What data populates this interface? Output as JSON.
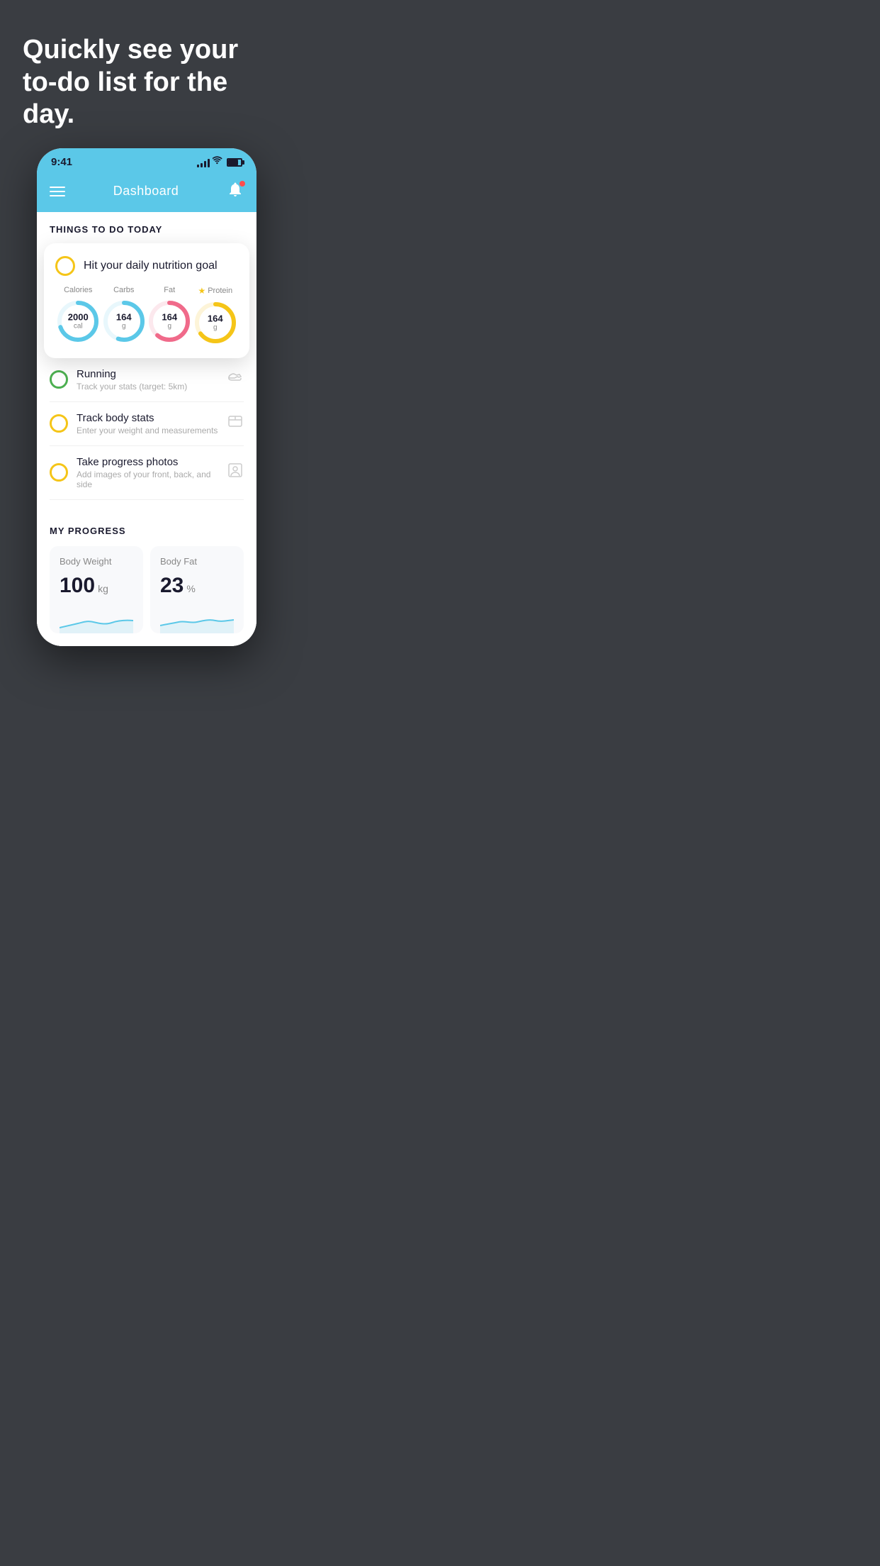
{
  "background_color": "#3a3d42",
  "hero": {
    "title": "Quickly see your to-do list for the day."
  },
  "phone": {
    "status_bar": {
      "time": "9:41",
      "signal_bars": [
        4,
        6,
        9,
        12,
        14
      ],
      "wifi": "wifi",
      "battery": "battery"
    },
    "nav": {
      "title": "Dashboard",
      "menu_label": "menu",
      "bell_label": "notifications"
    },
    "things_to_do": {
      "section_title": "THINGS TO DO TODAY"
    },
    "floating_card": {
      "goal_title": "Hit your daily nutrition goal",
      "nutrients": [
        {
          "label": "Calories",
          "value": "2000",
          "unit": "cal",
          "color": "#5bc8e8",
          "track_pct": 70,
          "star": false
        },
        {
          "label": "Carbs",
          "value": "164",
          "unit": "g",
          "color": "#5bc8e8",
          "track_pct": 55,
          "star": false
        },
        {
          "label": "Fat",
          "value": "164",
          "unit": "g",
          "color": "#f06a8a",
          "track_pct": 60,
          "star": false
        },
        {
          "label": "Protein",
          "value": "164",
          "unit": "g",
          "color": "#f5c518",
          "track_pct": 65,
          "star": true
        }
      ]
    },
    "todo_items": [
      {
        "id": "running",
        "title": "Running",
        "subtitle": "Track your stats (target: 5km)",
        "circle_color": "green",
        "icon": "shoe"
      },
      {
        "id": "track-body-stats",
        "title": "Track body stats",
        "subtitle": "Enter your weight and measurements",
        "circle_color": "yellow",
        "icon": "scale"
      },
      {
        "id": "progress-photos",
        "title": "Take progress photos",
        "subtitle": "Add images of your front, back, and side",
        "circle_color": "yellow",
        "icon": "person"
      }
    ],
    "progress": {
      "section_title": "MY PROGRESS",
      "cards": [
        {
          "id": "body-weight",
          "title": "Body Weight",
          "value": "100",
          "unit": "kg"
        },
        {
          "id": "body-fat",
          "title": "Body Fat",
          "value": "23",
          "unit": "%"
        }
      ]
    }
  }
}
